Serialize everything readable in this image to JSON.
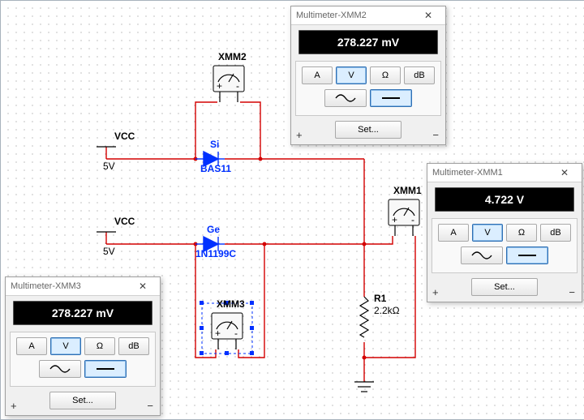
{
  "schematic": {
    "sources": {
      "vcc1": {
        "label": "VCC",
        "value": "5V"
      },
      "vcc2": {
        "label": "VCC",
        "value": "5V"
      }
    },
    "diodes": {
      "si": {
        "label": "Si",
        "part": "BAS11"
      },
      "ge": {
        "label": "Ge",
        "part": "1N1199C"
      }
    },
    "resistor": {
      "refdes": "R1",
      "value": "2.2kΩ"
    },
    "meters": {
      "xmm1": {
        "refdes": "XMM1"
      },
      "xmm2": {
        "refdes": "XMM2"
      },
      "xmm3": {
        "refdes": "XMM3"
      }
    }
  },
  "dialogs": {
    "xmm2": {
      "title": "Multimeter-XMM2",
      "reading": "278.227 mV",
      "modes": {
        "a": "A",
        "v": "V",
        "ohm": "Ω",
        "db": "dB",
        "selected": "V"
      },
      "wave_selected": "dc",
      "set": "Set..."
    },
    "xmm1": {
      "title": "Multimeter-XMM1",
      "reading": "4.722 V",
      "modes": {
        "a": "A",
        "v": "V",
        "ohm": "Ω",
        "db": "dB",
        "selected": "V"
      },
      "wave_selected": "dc",
      "set": "Set..."
    },
    "xmm3": {
      "title": "Multimeter-XMM3",
      "reading": "278.227 mV",
      "modes": {
        "a": "A",
        "v": "V",
        "ohm": "Ω",
        "db": "dB",
        "selected": "V"
      },
      "wave_selected": "dc",
      "set": "Set..."
    }
  }
}
